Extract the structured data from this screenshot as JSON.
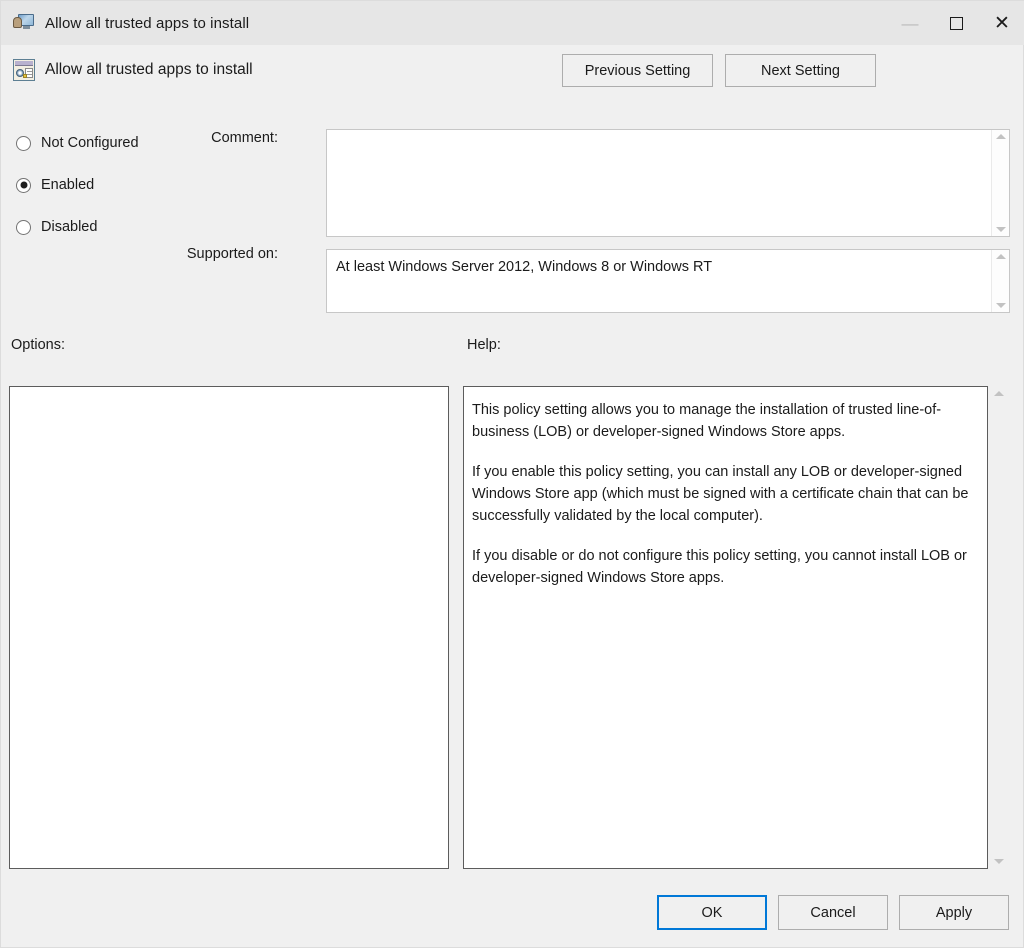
{
  "window": {
    "title": "Allow all trusted apps to install",
    "icon": "policy-monitor-user-icon",
    "controls": {
      "minimize": "—",
      "maximize": "□",
      "close": "✕"
    }
  },
  "header": {
    "title": "Allow all trusted apps to install",
    "icon": "policy-setting-icon",
    "previous_label": "Previous Setting",
    "next_label": "Next Setting"
  },
  "state": {
    "options": [
      {
        "label": "Not Configured",
        "selected": false
      },
      {
        "label": "Enabled",
        "selected": true
      },
      {
        "label": "Disabled",
        "selected": false
      }
    ]
  },
  "comment": {
    "label": "Comment:",
    "value": "",
    "placeholder": ""
  },
  "supported": {
    "label": "Supported on:",
    "value": "At least Windows Server 2012, Windows 8 or Windows RT"
  },
  "options_section": {
    "label": "Options:",
    "content": ""
  },
  "help_section": {
    "label": "Help:",
    "paragraphs": [
      "This policy setting allows you to manage the installation of trusted line-of-business (LOB) or developer-signed Windows Store apps.",
      "If you enable this policy setting, you can install any LOB or developer-signed Windows Store app (which must be signed with a certificate chain that can be successfully validated by the local computer).",
      "If you disable or do not configure this policy setting, you cannot install LOB or developer-signed Windows Store apps."
    ]
  },
  "footer": {
    "ok_label": "OK",
    "cancel_label": "Cancel",
    "apply_label": "Apply"
  },
  "colors": {
    "window_bg": "#f0f0f0",
    "titlebar_bg": "#e6e6e6",
    "panel_border": "#5c5c5c",
    "field_border": "#c7c7c7",
    "focus_accent": "#0078d7",
    "text": "#1b1b1b"
  }
}
